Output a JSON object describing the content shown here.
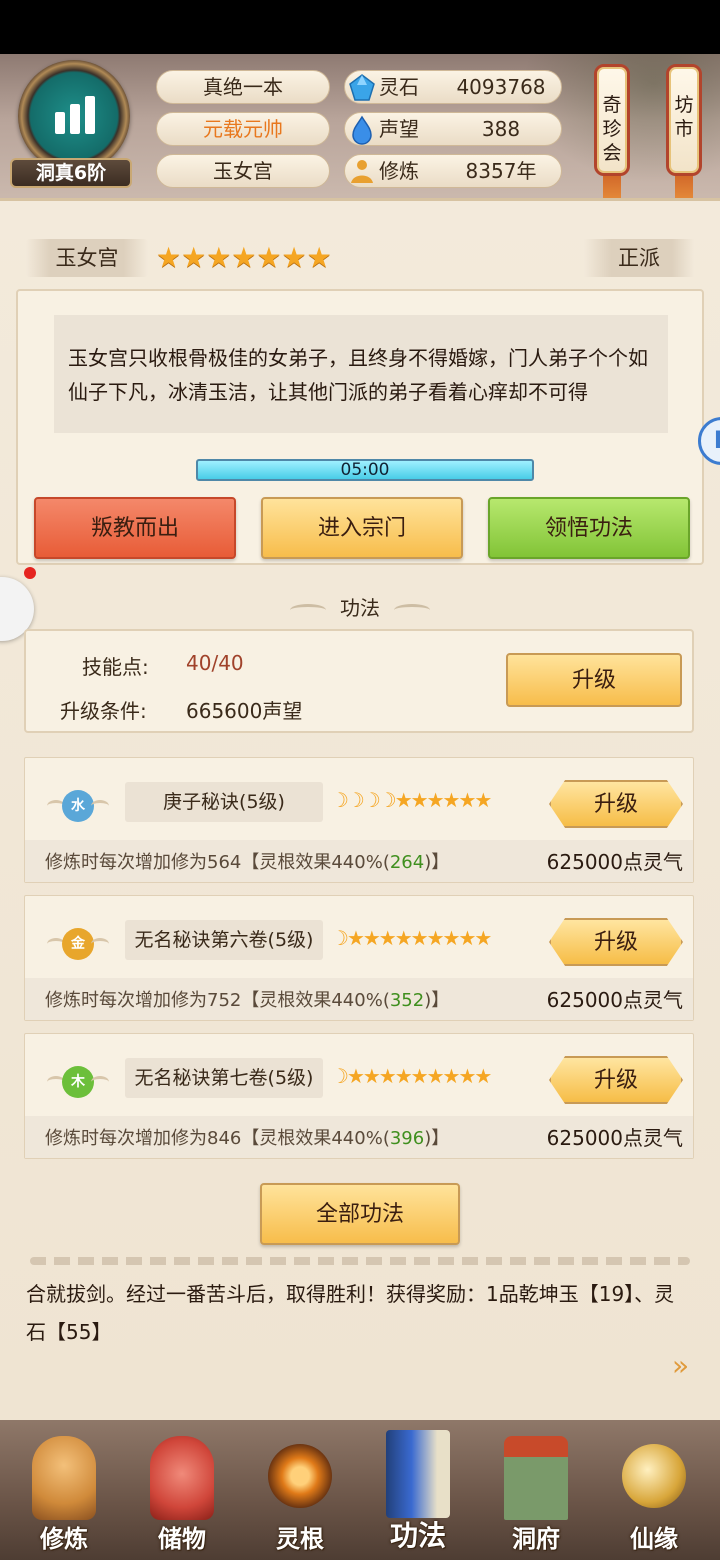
{
  "header": {
    "rank": "洞真6阶",
    "tags": [
      "真绝一本",
      "元载元帅",
      "玉女宫"
    ],
    "resources": [
      {
        "label": "灵石",
        "value": "4093768",
        "icon": "spirit-stone-icon"
      },
      {
        "label": "声望",
        "value": "388",
        "icon": "reputation-icon"
      },
      {
        "label": "修炼",
        "value": "8357年",
        "icon": "meditation-icon"
      }
    ],
    "lanterns": [
      {
        "label": "奇珍会",
        "lines": [
          "奇",
          "珍",
          "会"
        ]
      },
      {
        "label": "坊市",
        "lines": [
          "坊",
          "市"
        ]
      }
    ]
  },
  "sect": {
    "name": "玉女宫",
    "stars": "★★★★★★★",
    "faction": "正派",
    "side_tab": "F",
    "description": "玉女宫只收根骨极佳的女弟子，且终身不得婚嫁，门人弟子个个如仙子下凡，冰清玉洁，让其他门派的弟子看着心痒却不可得",
    "timer": "05:00",
    "buttons": {
      "leave": "叛教而出",
      "enter": "进入宗门",
      "comprehend": "领悟功法"
    }
  },
  "gongfa": {
    "title": "功法",
    "skill_points_label": "技能点:",
    "skill_points_value": "40/40",
    "upgrade_cond_label": "升级条件:",
    "upgrade_cond_value": "665600声望",
    "upgrade_button": "升级"
  },
  "techniques": [
    {
      "element": "水",
      "element_color": "#5aa7d8",
      "name": "庚子秘诀(5级)",
      "moons": "☽☽☽☽",
      "stars": "★★★★★★",
      "effect_prefix": "修炼时每次增加修为564【灵根效果440%(",
      "effect_bonus": "264",
      "effect_suffix": ")】",
      "cost": "625000点灵气",
      "button": "升级"
    },
    {
      "element": "金",
      "element_color": "#e8a62c",
      "name": "无名秘诀第六卷(5级)",
      "moons": "☽",
      "stars": "★★★★★★★★★",
      "effect_prefix": "修炼时每次增加修为752【灵根效果440%(",
      "effect_bonus": "352",
      "effect_suffix": ")】",
      "cost": "625000点灵气",
      "button": "升级"
    },
    {
      "element": "木",
      "element_color": "#6cbf3a",
      "name": "无名秘诀第七卷(5级)",
      "moons": "☽",
      "stars": "★★★★★★★★★",
      "effect_prefix": "修炼时每次增加修为846【灵根效果440%(",
      "effect_bonus": "396",
      "effect_suffix": ")】",
      "cost": "625000点灵气",
      "button": "升级"
    }
  ],
  "all_button": "全部功法",
  "log": "合就拔剑。经过一番苦斗后，取得胜利！获得奖励：1品乾坤玉【19】、灵石【55】",
  "nav": [
    {
      "label": "修炼",
      "icon": "cultivate-icon",
      "color": "#d08a3a"
    },
    {
      "label": "储物",
      "icon": "storage-bag-icon",
      "color": "#d0463a"
    },
    {
      "label": "灵根",
      "icon": "spirit-root-icon",
      "color": "#e07a18"
    },
    {
      "label": "功法",
      "icon": "technique-book-icon",
      "color": "#3a6ad0"
    },
    {
      "label": "洞府",
      "icon": "cave-mansion-icon",
      "color": "#7a9a6a"
    },
    {
      "label": "仙缘",
      "icon": "fortune-icon",
      "color": "#d8a63a"
    }
  ]
}
